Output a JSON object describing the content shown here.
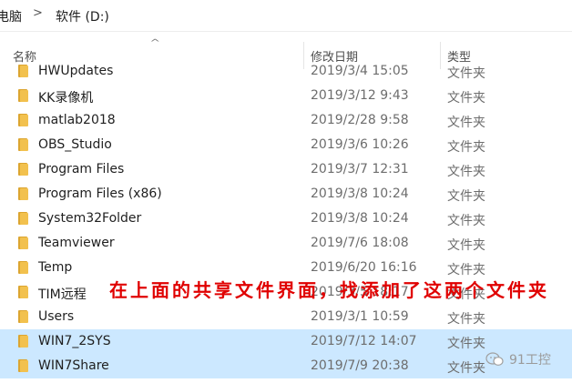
{
  "breadcrumb": {
    "items": [
      "电脑",
      "软件 (D:)"
    ],
    "separator": ">"
  },
  "columns": {
    "name": "名称",
    "date_modified": "修改日期",
    "type": "类型"
  },
  "files": [
    {
      "name": "HWUpdates",
      "date": "2019/3/4 15:05",
      "type": "文件夹",
      "selected": false
    },
    {
      "name": "KK录像机",
      "date": "2019/3/12 9:43",
      "type": "文件夹",
      "selected": false
    },
    {
      "name": "matlab2018",
      "date": "2019/2/28 9:58",
      "type": "文件夹",
      "selected": false
    },
    {
      "name": "OBS_Studio",
      "date": "2019/3/6 10:26",
      "type": "文件夹",
      "selected": false
    },
    {
      "name": "Program Files",
      "date": "2019/3/7 12:31",
      "type": "文件夹",
      "selected": false
    },
    {
      "name": "Program Files (x86)",
      "date": "2019/3/8 10:24",
      "type": "文件夹",
      "selected": false
    },
    {
      "name": "System32Folder",
      "date": "2019/3/8 10:24",
      "type": "文件夹",
      "selected": false
    },
    {
      "name": "Teamviewer",
      "date": "2019/7/6 18:08",
      "type": "文件夹",
      "selected": false
    },
    {
      "name": "Temp",
      "date": "2019/6/20 16:16",
      "type": "文件夹",
      "selected": false
    },
    {
      "name": "TIM远程",
      "date": "2019/3/5 18:17",
      "type": "文件夹",
      "selected": false
    },
    {
      "name": "Users",
      "date": "2019/3/1 10:59",
      "type": "文件夹",
      "selected": false
    },
    {
      "name": "WIN7_2SYS",
      "date": "2019/7/12 14:07",
      "type": "文件夹",
      "selected": true
    },
    {
      "name": "WIN7Share",
      "date": "2019/7/9 20:38",
      "type": "文件夹",
      "selected": true
    }
  ],
  "annotation": "在上面的共享文件界面，找添加了这两个文件夹",
  "watermark": "91工控",
  "colors": {
    "selection": "#cce8ff",
    "folder": "#f2c14e",
    "annotation": "#e00000"
  }
}
